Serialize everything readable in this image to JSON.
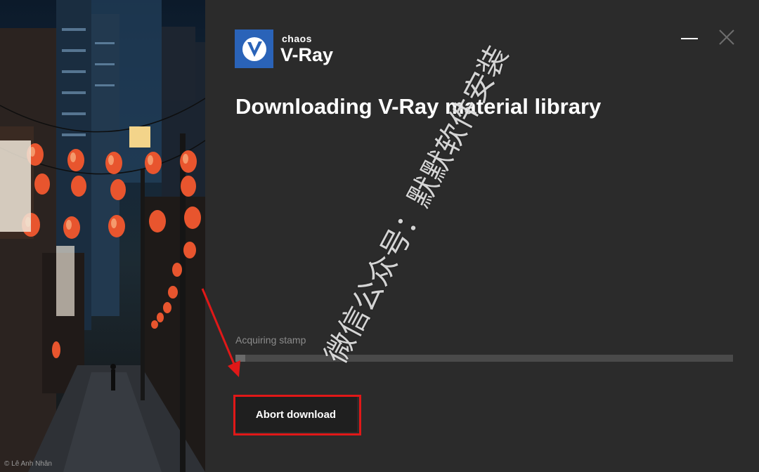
{
  "window": {
    "brand": "chaos",
    "product": "V-Ray",
    "title": "Downloading V-Ray material library"
  },
  "controls": {
    "minimize_icon": "minimize-icon",
    "close_icon": "close-icon"
  },
  "progress": {
    "status_text": "Acquiring stamp",
    "fraction": 0.02
  },
  "actions": {
    "abort_label": "Abort download"
  },
  "photo": {
    "credit": "© Lê Anh Nhân"
  },
  "annotation": {
    "watermark": "微信公众号：默默软件安装",
    "highlight_color": "#e01818"
  },
  "colors": {
    "background": "#2b2b2b",
    "logo_blue": "#2a63b8",
    "progress_track": "#4a4a4a",
    "button_bg": "#1f1f1f"
  }
}
